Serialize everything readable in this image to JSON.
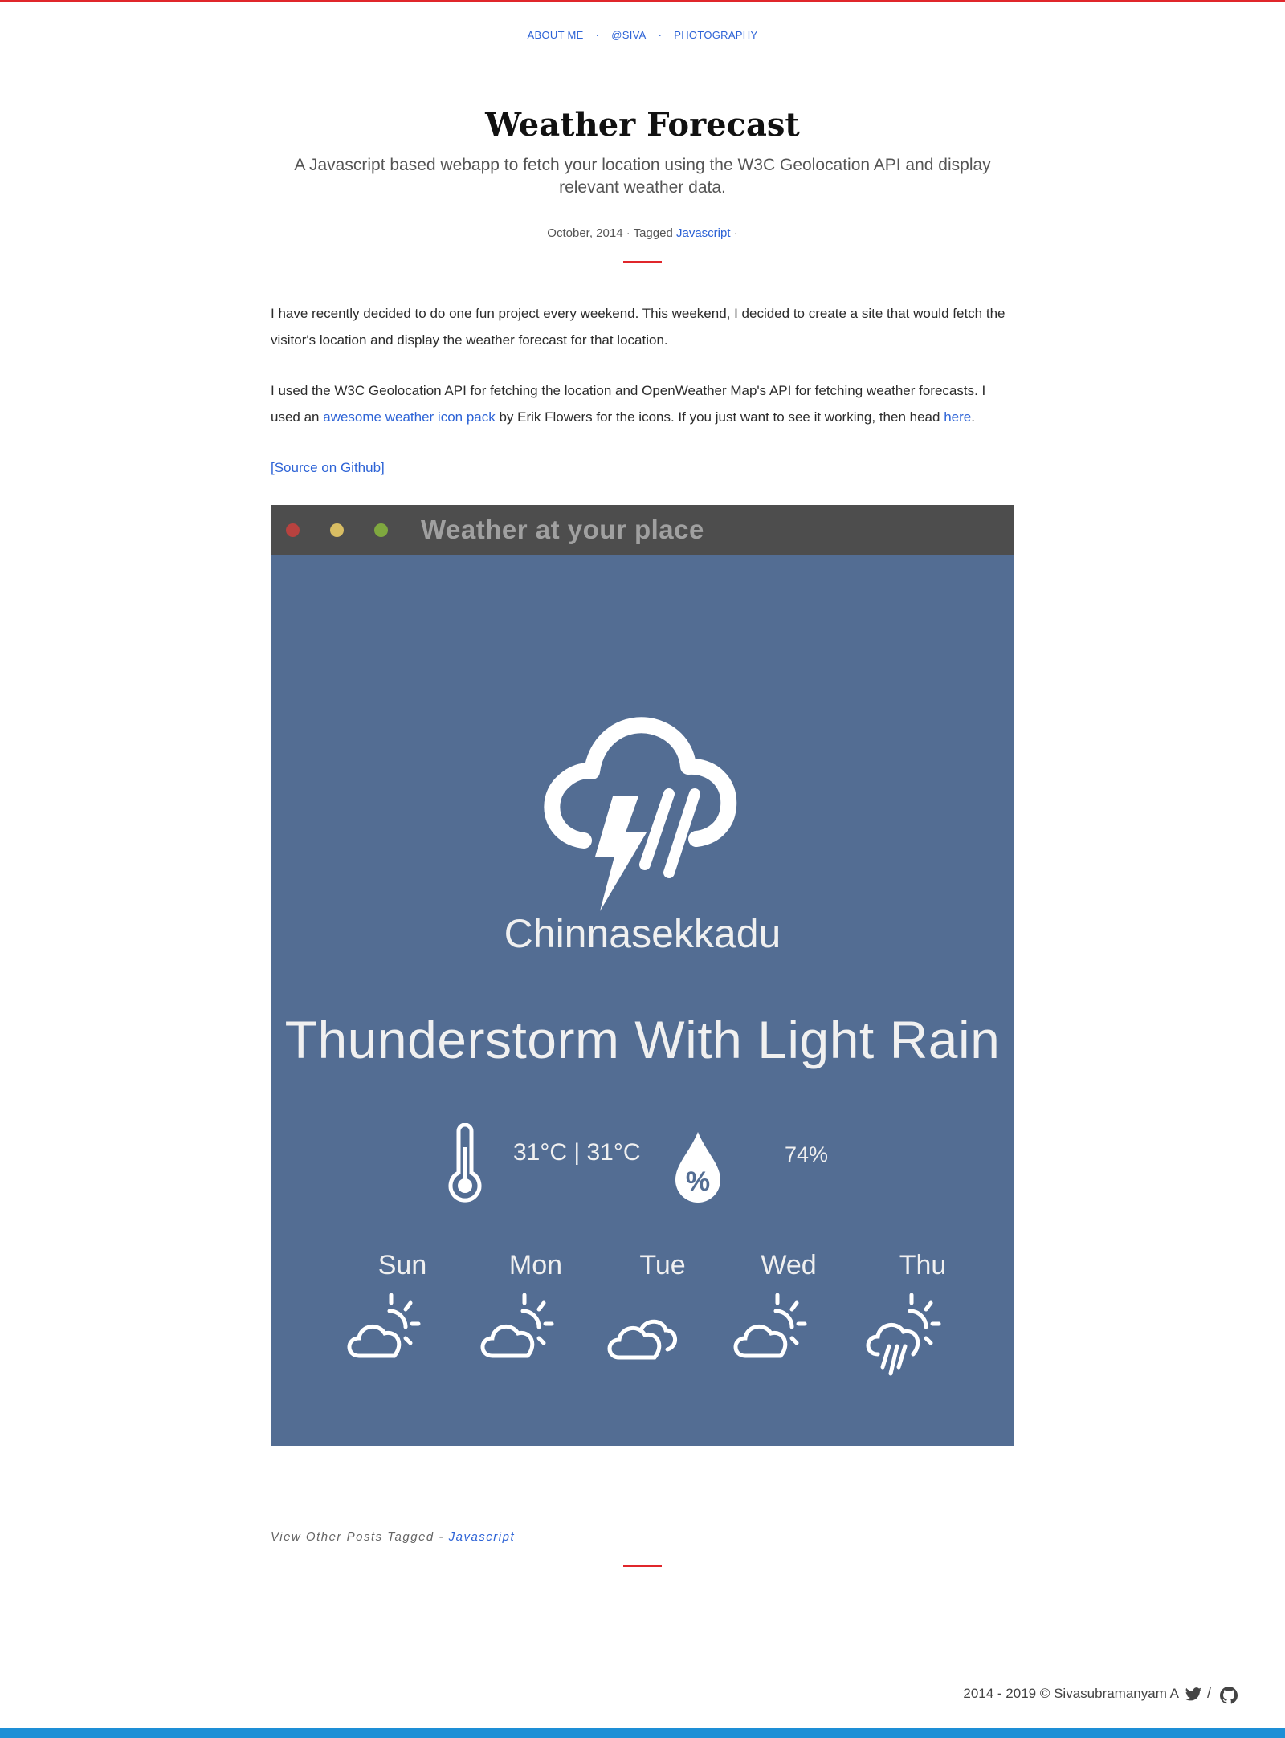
{
  "nav": {
    "items": [
      {
        "label": "About Me"
      },
      {
        "label": "@Siva"
      },
      {
        "label": "Photography"
      }
    ],
    "separator": "·"
  },
  "post": {
    "title": "Weather Forecast",
    "subtitle": "A Javascript based webapp to fetch your location using the W3C Geolocation API and display relevant weather data.",
    "date": "October, 2014",
    "tagged_prefix": "· Tagged",
    "tag": "Javascript",
    "tag_suffix": "·",
    "paragraph1": "I have recently decided to do one fun project every weekend. This weekend, I decided to create a site that would fetch the visitor's location and display the weather forecast for that location.",
    "paragraph2_a": "I used the W3C Geolocation API for fetching the location and OpenWeather Map's API for fetching weather forecasts. I used an ",
    "paragraph2_link1": "awesome weather icon pack",
    "paragraph2_b": " by Erik Flowers for the icons. If you just want to see it working, then head ",
    "paragraph2_link2": "here",
    "paragraph2_c": ".",
    "source_link": "[Source on Github]"
  },
  "screenshot": {
    "window_title": "Weather at your place",
    "city": "Chinnasekkadu",
    "condition": "Thunderstorm With Light Rain",
    "temperature": "31°C | 31°C",
    "humidity": "74%",
    "forecast": [
      {
        "day": "Sun",
        "icon": "day-cloudy-icon"
      },
      {
        "day": "Mon",
        "icon": "day-cloudy-icon"
      },
      {
        "day": "Tue",
        "icon": "cloudy-icon"
      },
      {
        "day": "Wed",
        "icon": "day-cloudy-icon"
      },
      {
        "day": "Thu",
        "icon": "day-rain-icon"
      }
    ],
    "colors": {
      "background": "#536d93",
      "titlebar": "#4d4d4d"
    }
  },
  "footer": {
    "view_other": "View Other Posts Tagged -",
    "tag": "Javascript",
    "copyright": "2014 - 2019 © Sivasubramanyam A",
    "slash": "/"
  },
  "colors": {
    "accent_red": "#e0262b",
    "link_blue": "#2d63d6",
    "bottom_bar": "#1e8fd6"
  }
}
